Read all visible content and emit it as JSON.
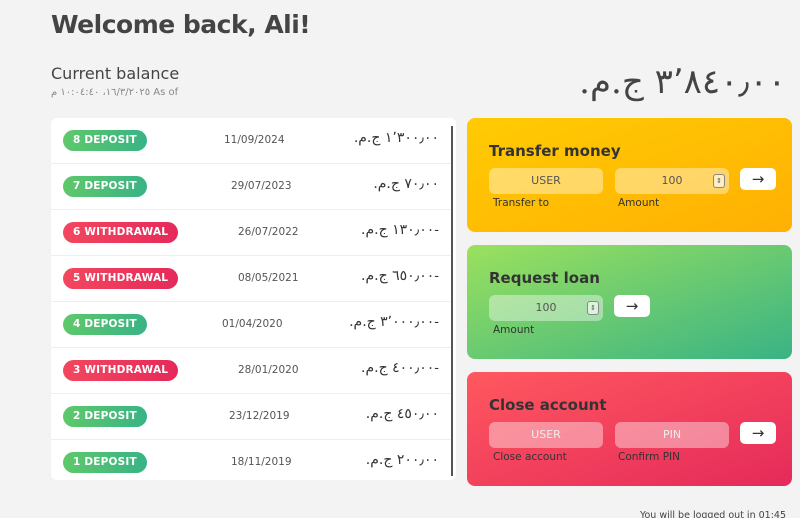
{
  "header": {
    "welcome": "Welcome back, Ali!"
  },
  "balance": {
    "label": "Current balance",
    "as_of": "As of ١٦/٣/٢٠٢٥، ١٠:٠٤:٤٠ م",
    "value": "٣٬٨٤٠٫٠٠ ج.م."
  },
  "movements": [
    {
      "type_label": "8 DEPOSIT",
      "kind": "deposit",
      "date": "11/09/2024",
      "value": "١٬٣٠٠٫٠٠ ج.م."
    },
    {
      "type_label": "7 DEPOSIT",
      "kind": "deposit",
      "date": "29/07/2023",
      "value": "٧٠٫٠٠ ج.م."
    },
    {
      "type_label": "6 WITHDRAWAL",
      "kind": "withdrawal",
      "date": "26/07/2022",
      "value": "-١٣٠٫٠٠ ج.م."
    },
    {
      "type_label": "5 WITHDRAWAL",
      "kind": "withdrawal",
      "date": "08/05/2021",
      "value": "-٦٥٠٫٠٠ ج.م."
    },
    {
      "type_label": "4 DEPOSIT",
      "kind": "deposit",
      "date": "01/04/2020",
      "value": "-٣٬٠٠٠٫٠٠ ج.م."
    },
    {
      "type_label": "3 WITHDRAWAL",
      "kind": "withdrawal",
      "date": "28/01/2020",
      "value": "-٤٠٠٫٠٠ ج.م."
    },
    {
      "type_label": "2 DEPOSIT",
      "kind": "deposit",
      "date": "23/12/2019",
      "value": "٤٥٠٫٠٠ ج.م."
    },
    {
      "type_label": "1 DEPOSIT",
      "kind": "deposit",
      "date": "18/11/2019",
      "value": "٢٠٠٫٠٠ ج.م."
    }
  ],
  "transfer": {
    "title": "Transfer money",
    "to_placeholder": "USER",
    "amount_value": "100",
    "to_label": "Transfer to",
    "amount_label": "Amount",
    "button": "→"
  },
  "loan": {
    "title": "Request loan",
    "amount_value": "100",
    "amount_label": "Amount",
    "button": "→"
  },
  "close": {
    "title": "Close account",
    "user_placeholder": "USER",
    "pin_placeholder": "PIN",
    "user_label": "Close account",
    "pin_label": "Confirm PIN",
    "button": "→"
  },
  "footer": {
    "logout": "You will be logged out in 01:45"
  },
  "colors": {
    "deposit": "#39b385",
    "withdrawal": "#e52a5a",
    "transfer": "#ffb003",
    "loan": "#39b385",
    "close": "#e52a5a"
  }
}
